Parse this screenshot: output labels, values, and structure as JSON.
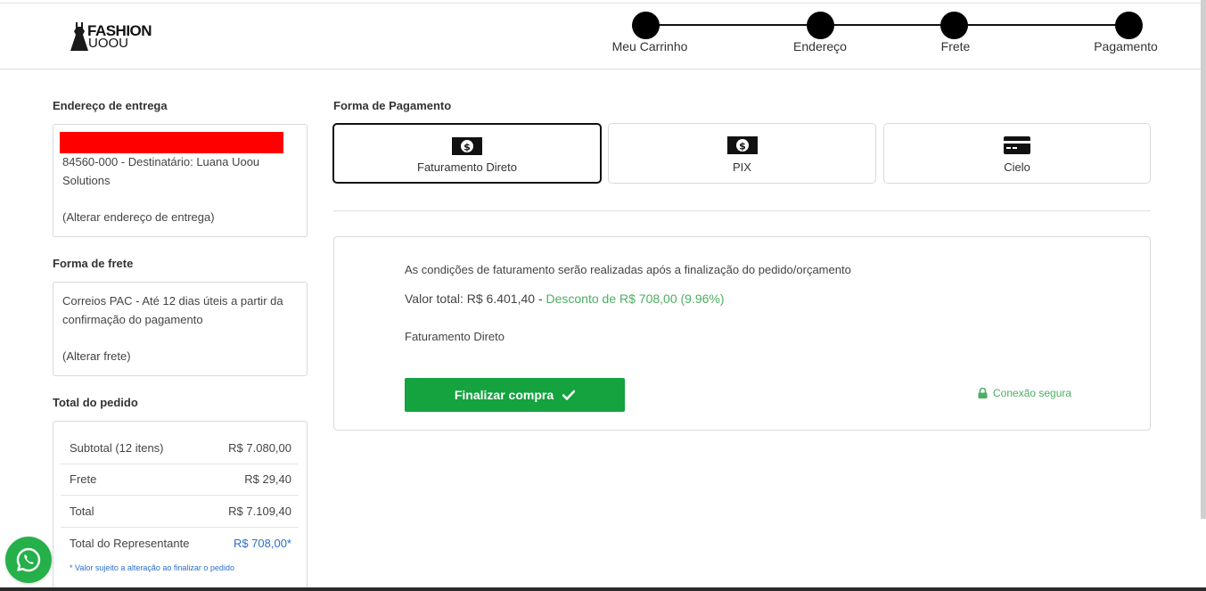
{
  "header": {
    "logo_line1": "FASHION",
    "logo_line2": "UOOU"
  },
  "steps": [
    {
      "label": "Meu Carrinho"
    },
    {
      "label": "Endereço"
    },
    {
      "label": "Frete"
    },
    {
      "label": "Pagamento"
    }
  ],
  "address": {
    "title": "Endereço de entrega",
    "line1": "84560-000 - Destinatário: Luana Uoou",
    "line2": "Solutions",
    "change_link": "(Alterar endereço de entrega)"
  },
  "shipping": {
    "title": "Forma de frete",
    "line1": "Correios PAC - Até 12 dias úteis a partir da",
    "line2": "confirmação do pagamento",
    "change_link": "(Alterar frete)"
  },
  "order_total": {
    "title": "Total do pedido",
    "rows": [
      {
        "label": "Subtotal (12 itens)",
        "value": "R$ 7.080,00"
      },
      {
        "label": "Frete",
        "value": "R$ 29,40"
      },
      {
        "label": "Total",
        "value": "R$ 7.109,40"
      },
      {
        "label": "Total do Representante",
        "value": "R$ 708,00*"
      }
    ],
    "note": "* Valor sujeito a alteração ao finalizar o pedido"
  },
  "payment": {
    "title": "Forma de Pagamento",
    "options": [
      {
        "label": "Faturamento Direto",
        "icon": "money-icon",
        "selected": true
      },
      {
        "label": "PIX",
        "icon": "money-icon",
        "selected": false
      },
      {
        "label": "Cielo",
        "icon": "credit-card-icon",
        "selected": false
      }
    ],
    "conditions": "As condições de faturamento serão realizadas após a finalização do pedido/orçamento",
    "total_label": "Valor total: R$ 6.401,40 -",
    "discount": "Desconto de R$ 708,00 (9.96%)",
    "method": "Faturamento Direto",
    "finish_button": "Finalizar compra",
    "secure_label": "Conexão segura"
  },
  "colors": {
    "finish_green": "#14a33f",
    "discount_green": "#4cae63",
    "rep_blue": "#2d6fc7",
    "redaction_red": "#ff0000",
    "whatsapp_green": "#25b04a"
  }
}
